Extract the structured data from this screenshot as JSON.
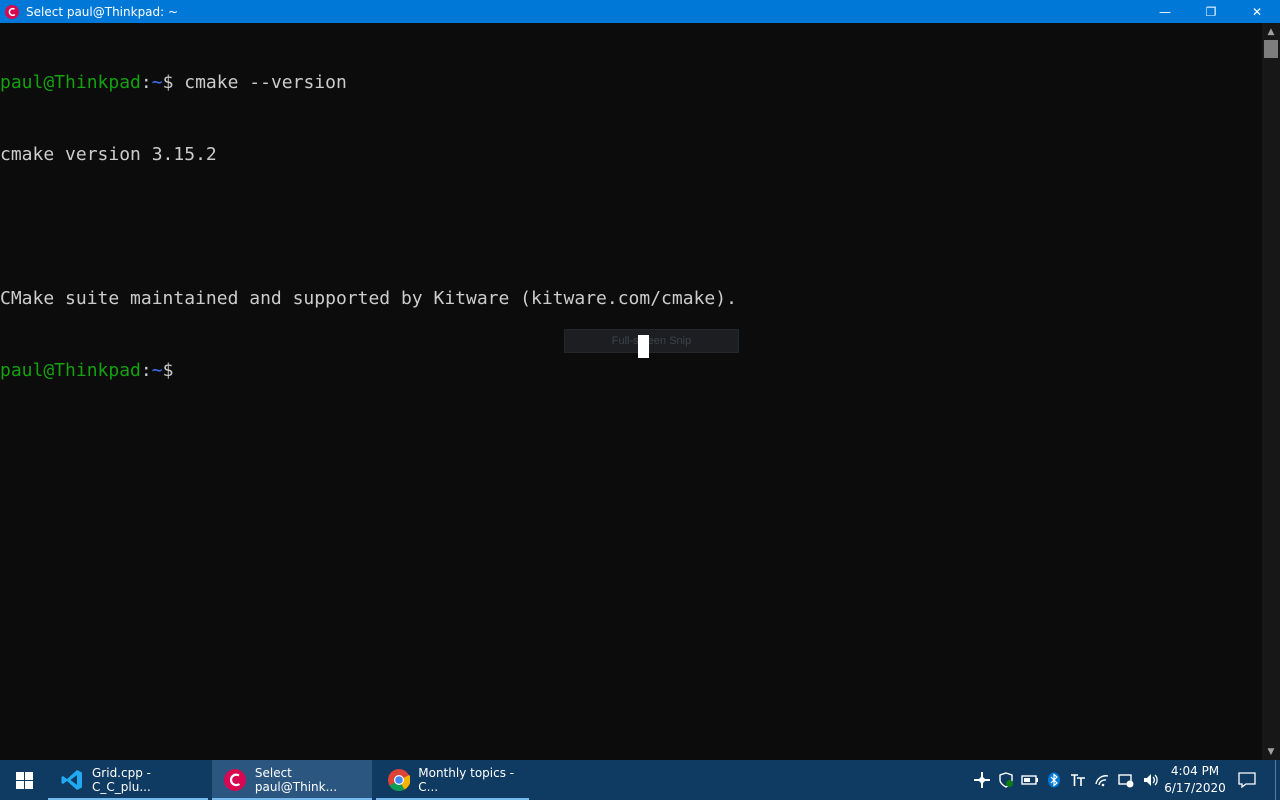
{
  "window": {
    "title": "Select paul@Thinkpad: ~",
    "controls": {
      "minimize": "—",
      "maximize": "❐",
      "close": "✕"
    }
  },
  "terminal": {
    "lines": [
      {
        "user": "paul@Thinkpad",
        "colon": ":",
        "path": "~",
        "dollar": "$",
        "command": " cmake --version"
      },
      {
        "text": "cmake version 3.15.2"
      },
      {
        "text": ""
      },
      {
        "text": "CMake suite maintained and supported by Kitware (kitware.com/cmake)."
      },
      {
        "user": "paul@Thinkpad",
        "colon": ":",
        "path": "~",
        "dollar": "$",
        "command": ""
      }
    ]
  },
  "snip_popup": {
    "label": "Full-screen Snip"
  },
  "taskbar": {
    "items": [
      {
        "label": "Grid.cpp - C_C_plu...",
        "icon": "vscode-icon"
      },
      {
        "label": "Select paul@Think...",
        "icon": "debian-icon"
      },
      {
        "label": "Monthly topics - C...",
        "icon": "chrome-icon"
      }
    ],
    "clock": {
      "time": "4:04 PM",
      "date": "6/17/2020"
    }
  },
  "colors": {
    "titlebar": "#0078d7",
    "prompt_user": "#13a10e",
    "prompt_path": "#3b78ff",
    "taskbar": "#0f3a61"
  }
}
